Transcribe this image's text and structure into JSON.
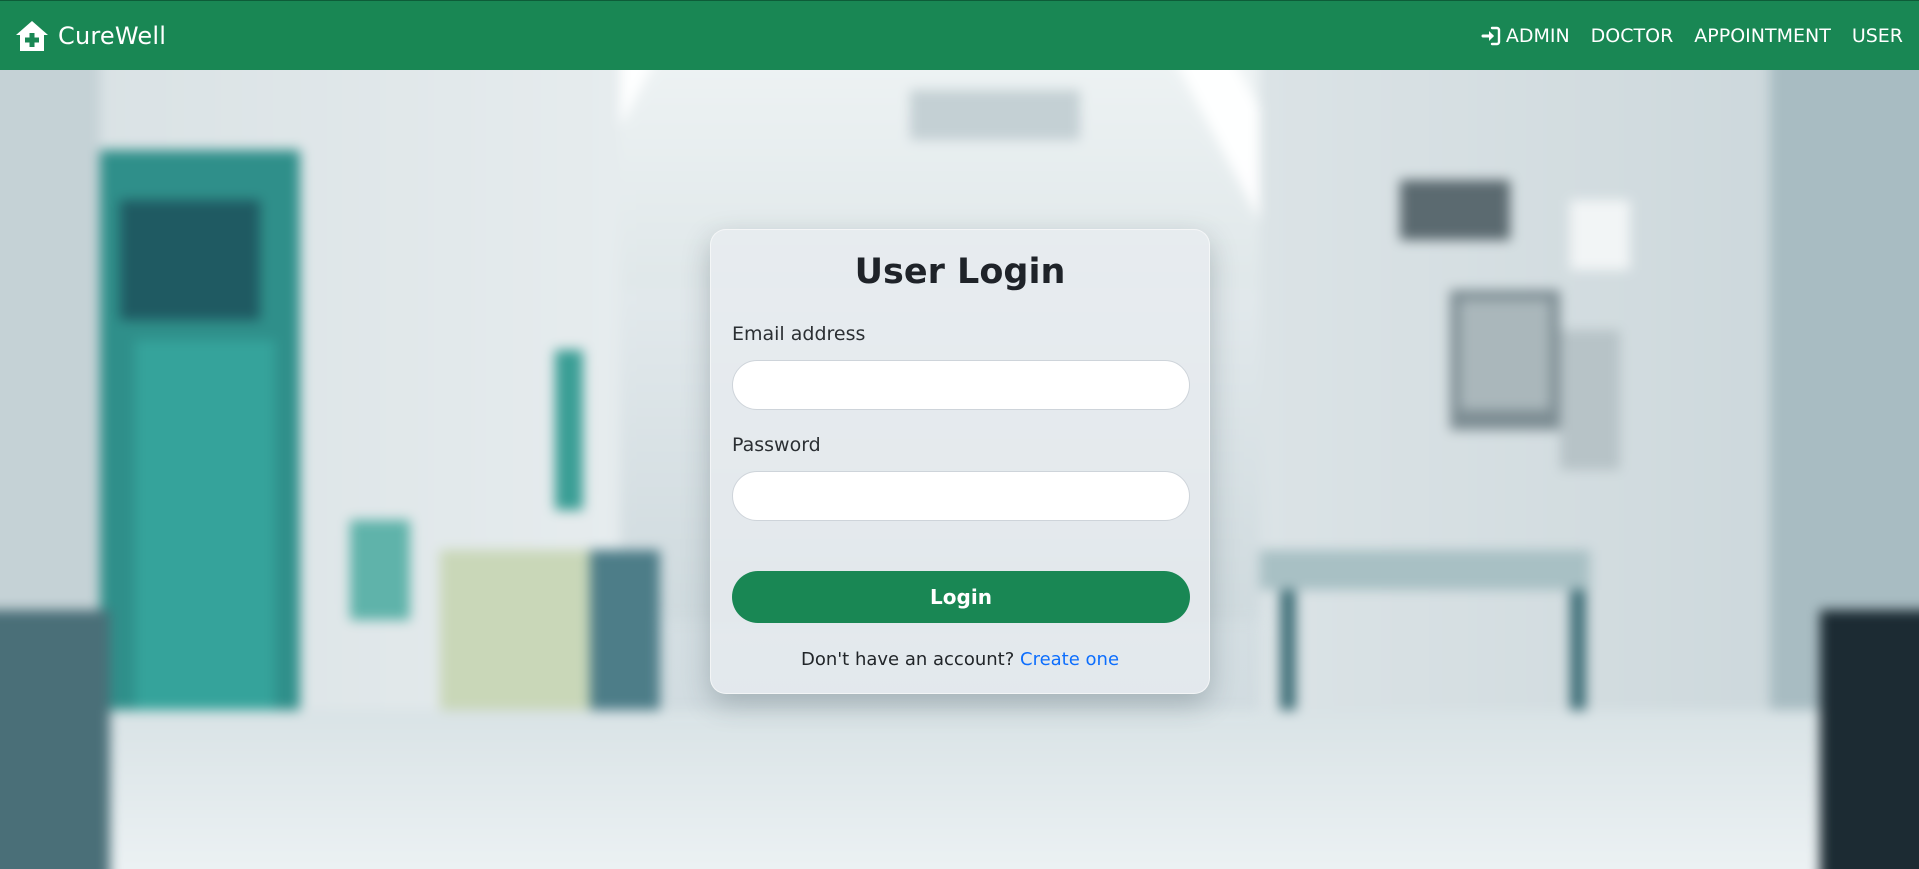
{
  "navbar": {
    "brand_text": "CureWell",
    "brand_icon": "house-medical-icon",
    "links": [
      {
        "label": "ADMIN",
        "icon": "sign-in-icon"
      },
      {
        "label": "DOCTOR"
      },
      {
        "label": "APPOINTMENT"
      },
      {
        "label": "USER"
      }
    ]
  },
  "background": {
    "description_icon": "hospital-corridor-background"
  },
  "login_card": {
    "title": "User Login",
    "email_label": "Email address",
    "email_value": "",
    "password_label": "Password",
    "password_value": "",
    "submit_label": "Login",
    "signup_prompt": "Don't have an account?",
    "signup_link": "Create one"
  },
  "colors": {
    "primary": "#198754",
    "link": "#0d6efd",
    "title": "#1f2329"
  }
}
